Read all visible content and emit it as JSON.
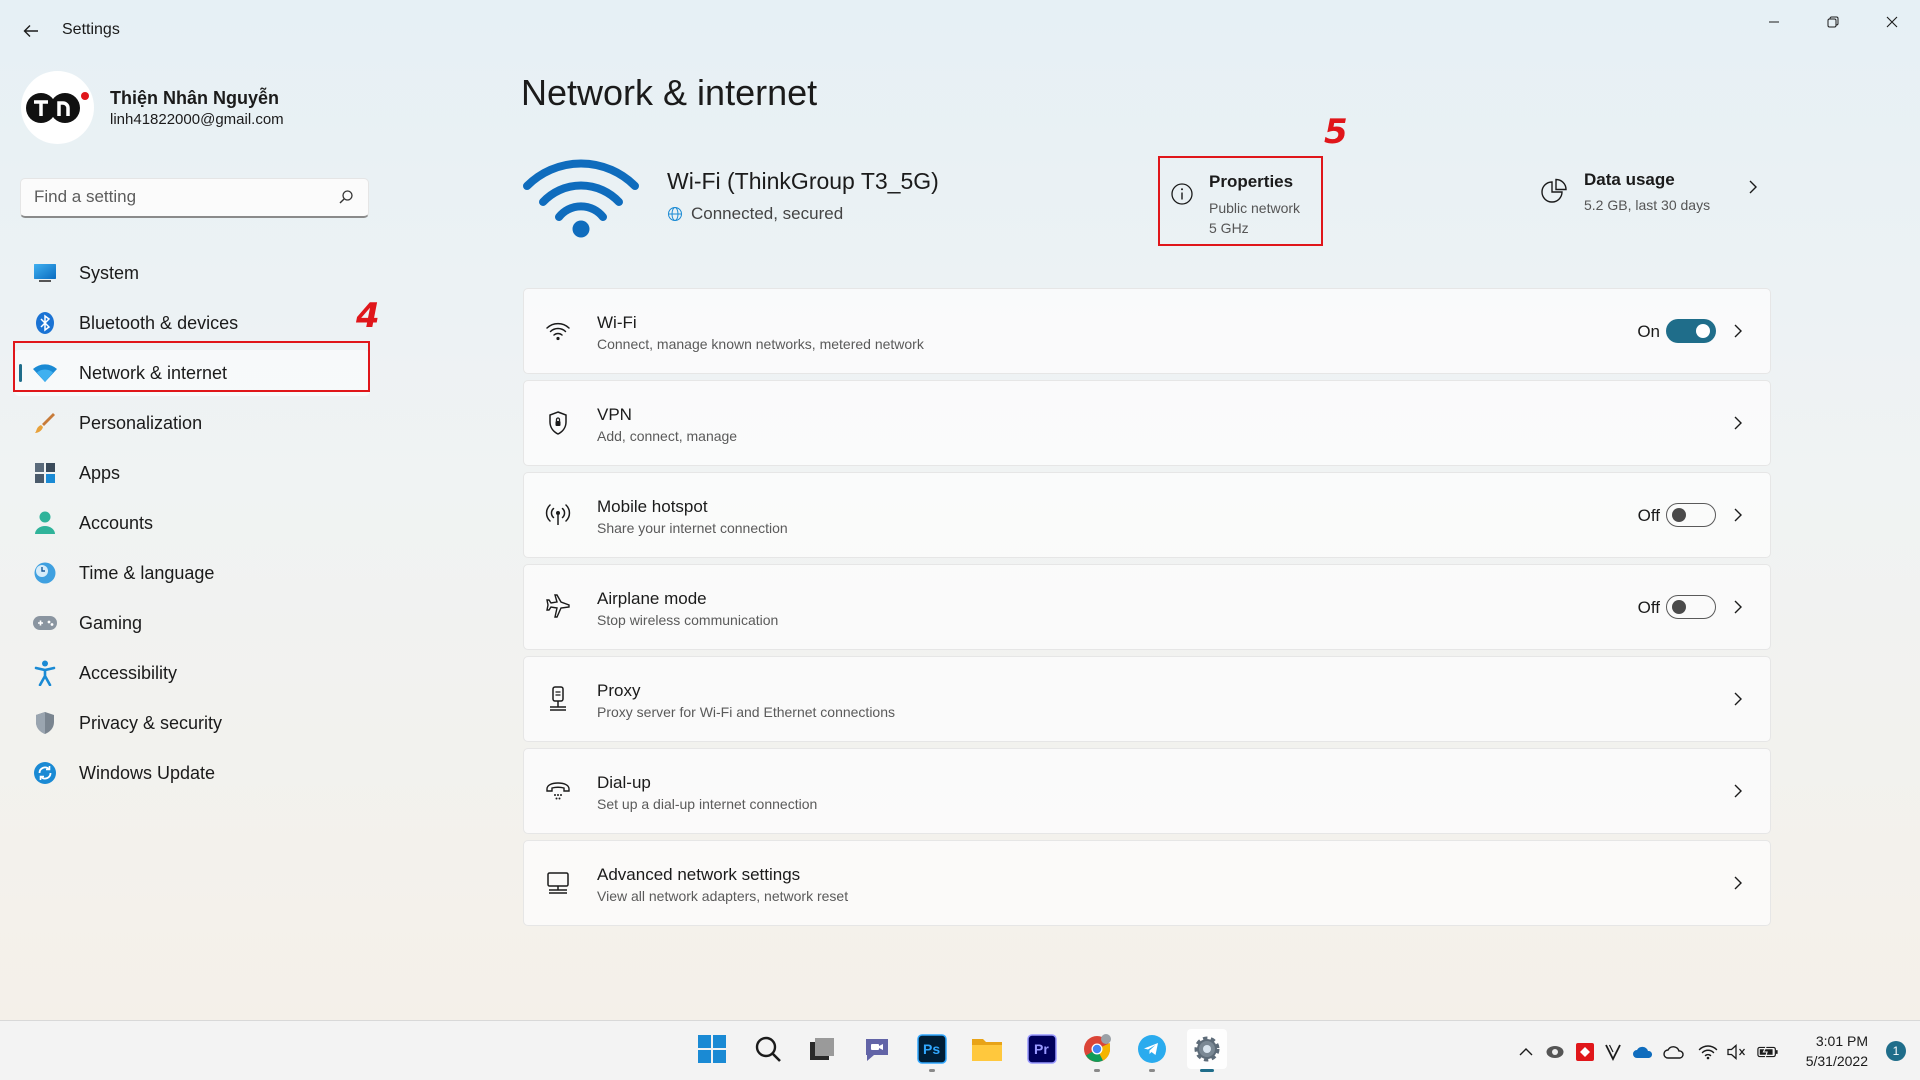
{
  "window": {
    "title": "Settings"
  },
  "profile": {
    "name": "Thiện Nhân Nguyễn",
    "email": "linh41822000@gmail.com",
    "initials": "TN"
  },
  "search": {
    "placeholder": "Find a setting"
  },
  "sidebar": {
    "items": [
      {
        "label": "System",
        "icon": "system-icon"
      },
      {
        "label": "Bluetooth & devices",
        "icon": "bluetooth-icon"
      },
      {
        "label": "Network & internet",
        "icon": "wifi-icon",
        "active": true
      },
      {
        "label": "Personalization",
        "icon": "brush-icon"
      },
      {
        "label": "Apps",
        "icon": "apps-icon"
      },
      {
        "label": "Accounts",
        "icon": "person-icon"
      },
      {
        "label": "Time & language",
        "icon": "clock-globe-icon"
      },
      {
        "label": "Gaming",
        "icon": "gamepad-icon"
      },
      {
        "label": "Accessibility",
        "icon": "accessibility-icon"
      },
      {
        "label": "Privacy & security",
        "icon": "shield-icon"
      },
      {
        "label": "Windows Update",
        "icon": "update-icon"
      }
    ]
  },
  "annotations": {
    "step4": "4",
    "step5": "5"
  },
  "main": {
    "title": "Network & internet",
    "connection": {
      "name": "Wi-Fi (ThinkGroup T3_5G)",
      "status": "Connected, secured"
    },
    "properties": {
      "title": "Properties",
      "line1": "Public network",
      "line2": "5 GHz"
    },
    "data_usage": {
      "title": "Data usage",
      "subtitle": "5.2 GB, last 30 days"
    },
    "cards": [
      {
        "title": "Wi-Fi",
        "subtitle": "Connect, manage known networks, metered network",
        "toggle": "On"
      },
      {
        "title": "VPN",
        "subtitle": "Add, connect, manage"
      },
      {
        "title": "Mobile hotspot",
        "subtitle": "Share your internet connection",
        "toggle": "Off"
      },
      {
        "title": "Airplane mode",
        "subtitle": "Stop wireless communication",
        "toggle": "Off"
      },
      {
        "title": "Proxy",
        "subtitle": "Proxy server for Wi-Fi and Ethernet connections"
      },
      {
        "title": "Dial-up",
        "subtitle": "Set up a dial-up internet connection"
      },
      {
        "title": "Advanced network settings",
        "subtitle": "View all network adapters, network reset"
      }
    ]
  },
  "taskbar": {
    "apps": [
      "start",
      "search",
      "task-view",
      "chat",
      "photoshop",
      "file-explorer",
      "premiere",
      "chrome",
      "telegram",
      "settings"
    ],
    "app_labels": {
      "photoshop": "Ps",
      "premiere": "Pr"
    },
    "time": "3:01 PM",
    "date": "5/31/2022",
    "notification_count": "1"
  },
  "colors": {
    "accent": "#1f6d8a",
    "annotation": "#e0161a"
  }
}
